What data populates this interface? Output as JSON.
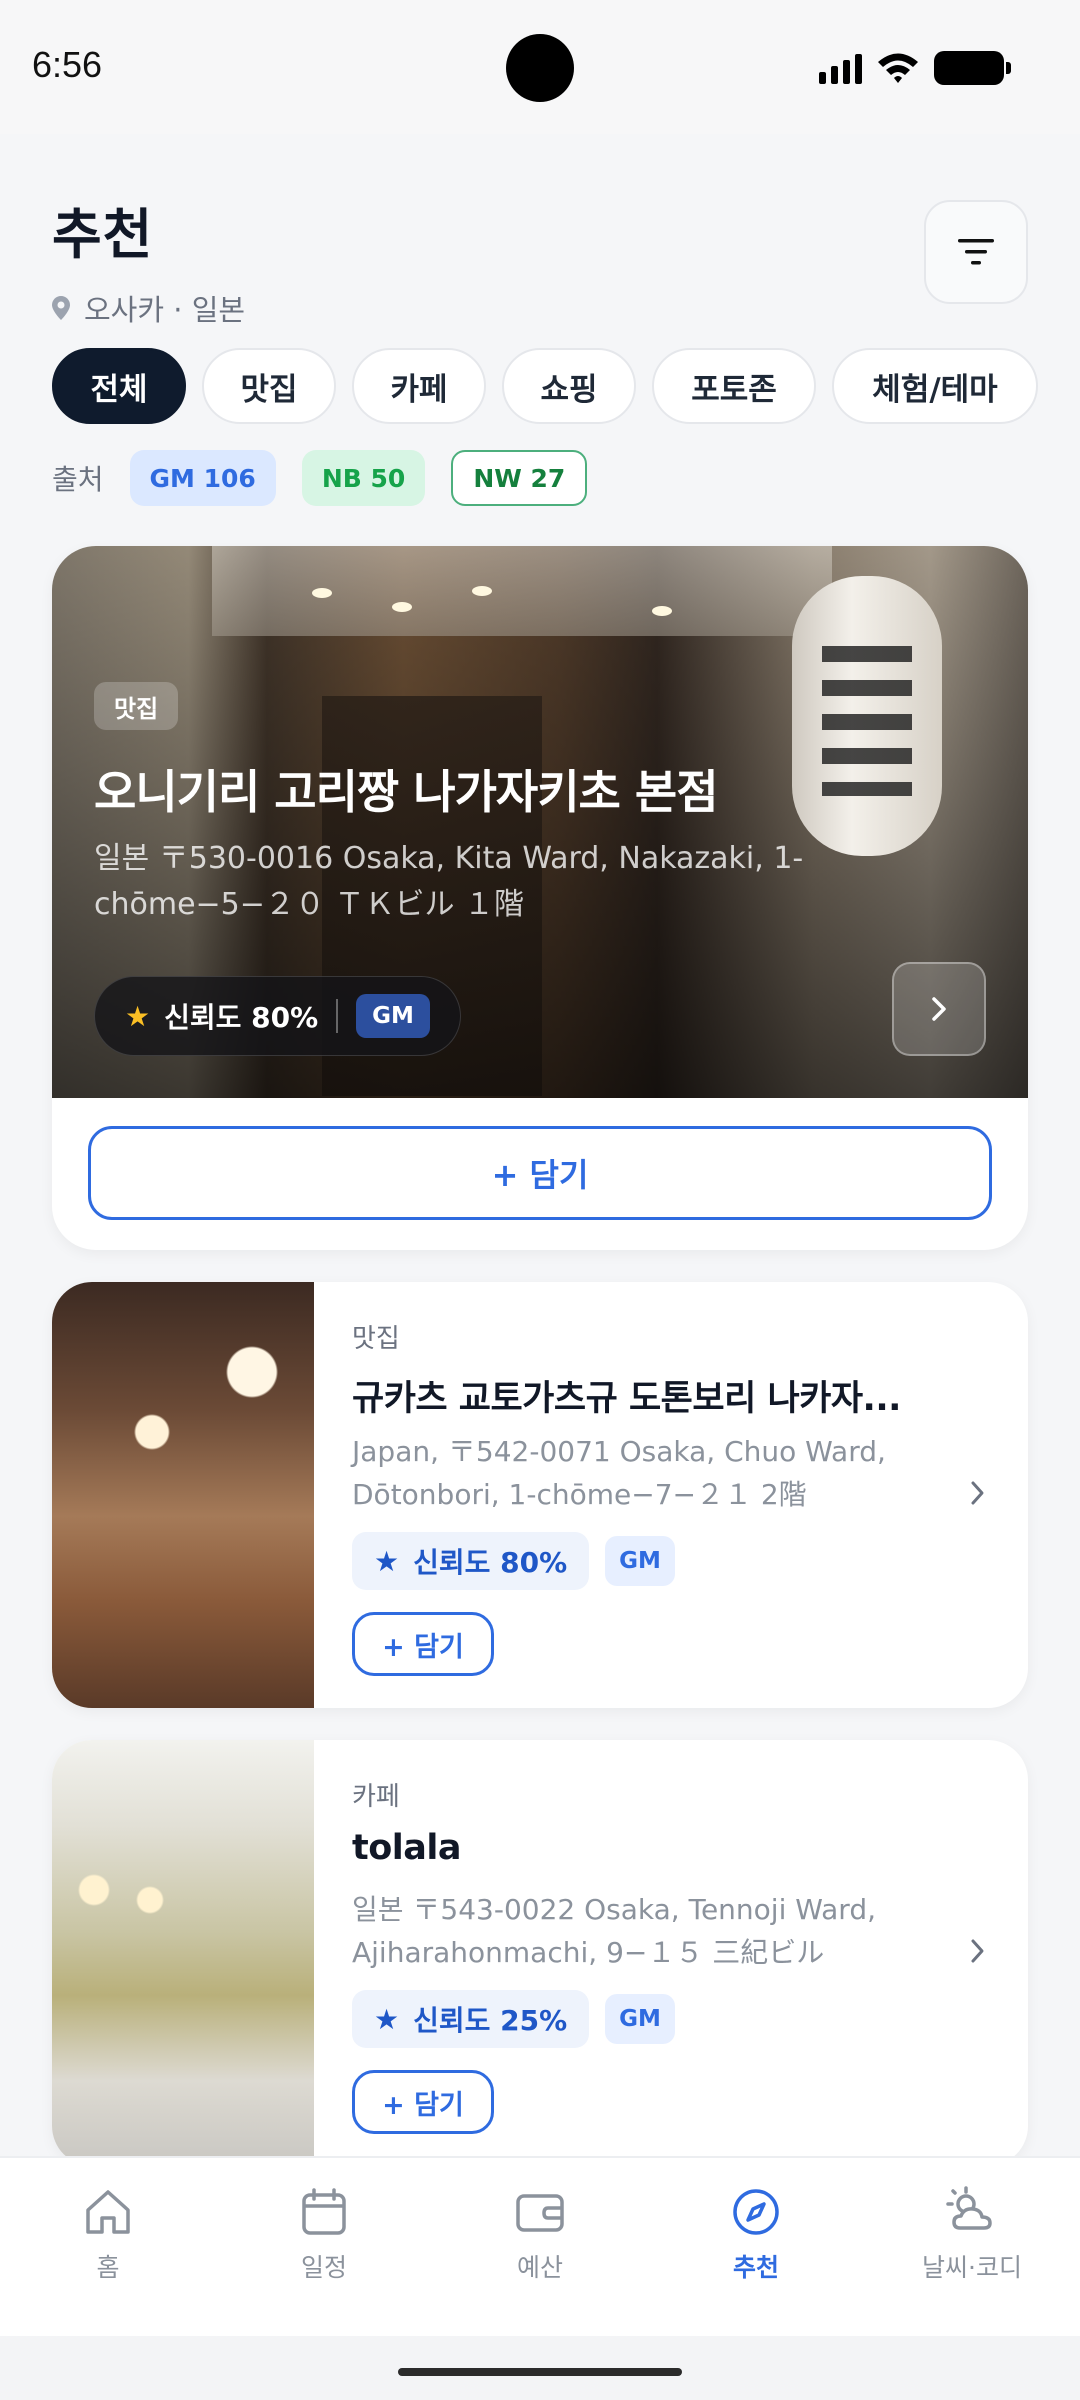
{
  "status_bar": {
    "time": "6:56"
  },
  "header": {
    "title": "추천",
    "location": "오사카 · 일본"
  },
  "categories": [
    "전체",
    "맛집",
    "카페",
    "쇼핑",
    "포토존",
    "체험/테마"
  ],
  "active_category": "전체",
  "sources": {
    "label": "출처",
    "gm": "GM 106",
    "nb": "NB 50",
    "nw": "NW 27"
  },
  "featured": {
    "category": "맛집",
    "title": "오니기리 고리짱 나가자키초 본점",
    "address": "일본 〒530-0016 Osaka, Kita Ward, Nakazaki, 1-chōme−5−２０ ＴＫビル １階",
    "trust": "신뢰도 80%",
    "source": "GM",
    "add_label": "+ 담기"
  },
  "places": [
    {
      "category": "맛집",
      "title": "규카츠 교토가츠규 도톤보리 나카자...",
      "address": "Japan, 〒542-0071 Osaka, Chuo Ward, Dōtonbori, 1-chōme−7−２１ 2階",
      "trust": "신뢰도 80%",
      "source": "GM",
      "add_label": "+ 담기"
    },
    {
      "category": "카페",
      "title": "tolala",
      "address": "일본 〒543-0022 Osaka, Tennoji Ward, Ajiharahonmachi, 9−１５ 三紀ビル",
      "trust": "신뢰도 25%",
      "source": "GM",
      "add_label": "+ 담기"
    }
  ],
  "bottom_nav": [
    {
      "label": "홈",
      "icon": "home-icon"
    },
    {
      "label": "일정",
      "icon": "calendar-icon"
    },
    {
      "label": "예산",
      "icon": "wallet-icon"
    },
    {
      "label": "추천",
      "icon": "compass-icon",
      "active": true
    },
    {
      "label": "날씨·코디",
      "icon": "weather-icon"
    }
  ],
  "colors": {
    "accent": "#2f6be0",
    "chip_active": "#0f1b2d"
  }
}
